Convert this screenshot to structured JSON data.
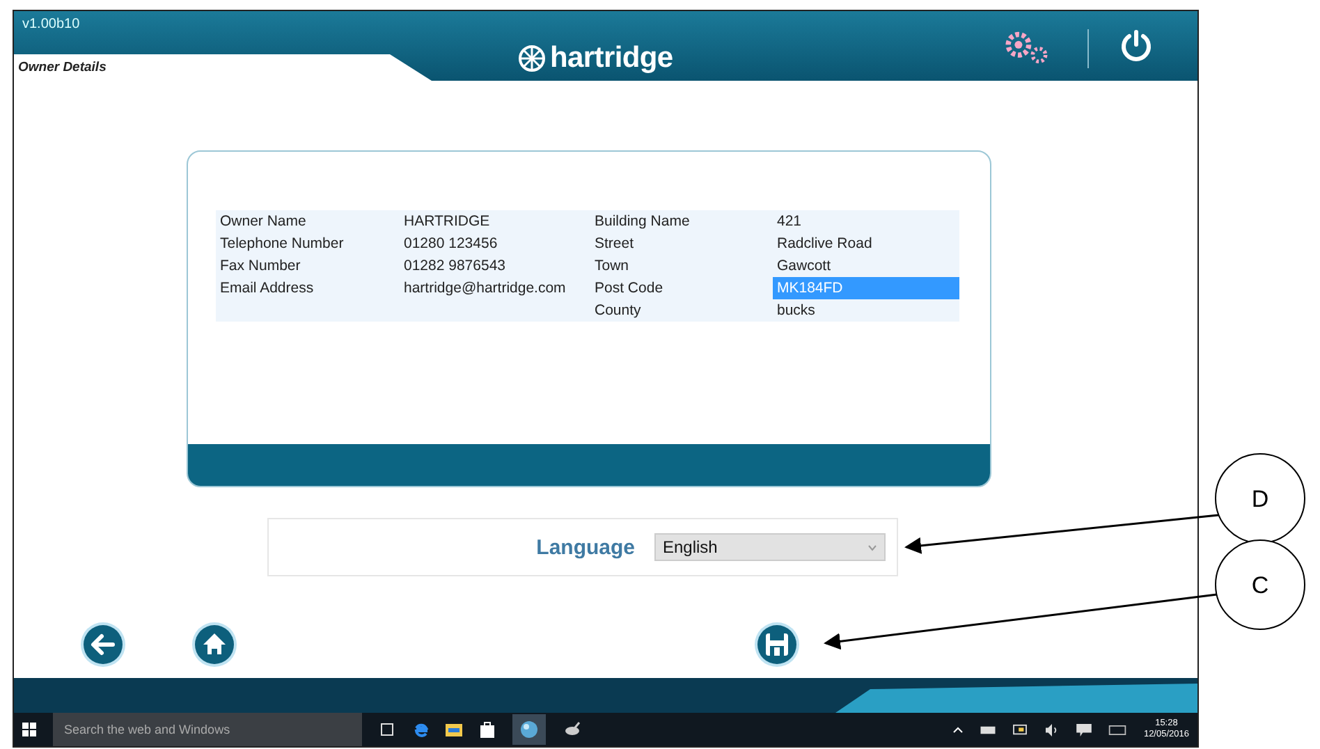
{
  "app": {
    "version": "v1.00b10",
    "page_title": "Owner Details",
    "brand": "hartridge"
  },
  "details": {
    "rows": [
      {
        "left": {
          "label": "Owner Name",
          "value": "HARTRIDGE",
          "selected": false
        },
        "right": {
          "label": "Building Name",
          "value": "421",
          "selected": false
        }
      },
      {
        "left": {
          "label": "Telephone Number",
          "value": "01280 123456",
          "selected": false
        },
        "right": {
          "label": "Street",
          "value": "Radclive Road",
          "selected": false
        }
      },
      {
        "left": {
          "label": "Fax Number",
          "value": "01282 9876543",
          "selected": false
        },
        "right": {
          "label": "Town",
          "value": "Gawcott",
          "selected": false
        }
      },
      {
        "left": {
          "label": "Email Address",
          "value": "hartridge@hartridge.com",
          "selected": false
        },
        "right": {
          "label": "Post Code",
          "value": "MK184FD",
          "selected": true
        }
      },
      {
        "right": {
          "label": "County",
          "value": "bucks",
          "selected": false
        }
      }
    ]
  },
  "language": {
    "label": "Language",
    "value": "English"
  },
  "taskbar": {
    "search_placeholder": "Search the web and Windows",
    "time": "15:28",
    "date": "12/05/2016"
  },
  "callouts": [
    "D",
    "C"
  ]
}
